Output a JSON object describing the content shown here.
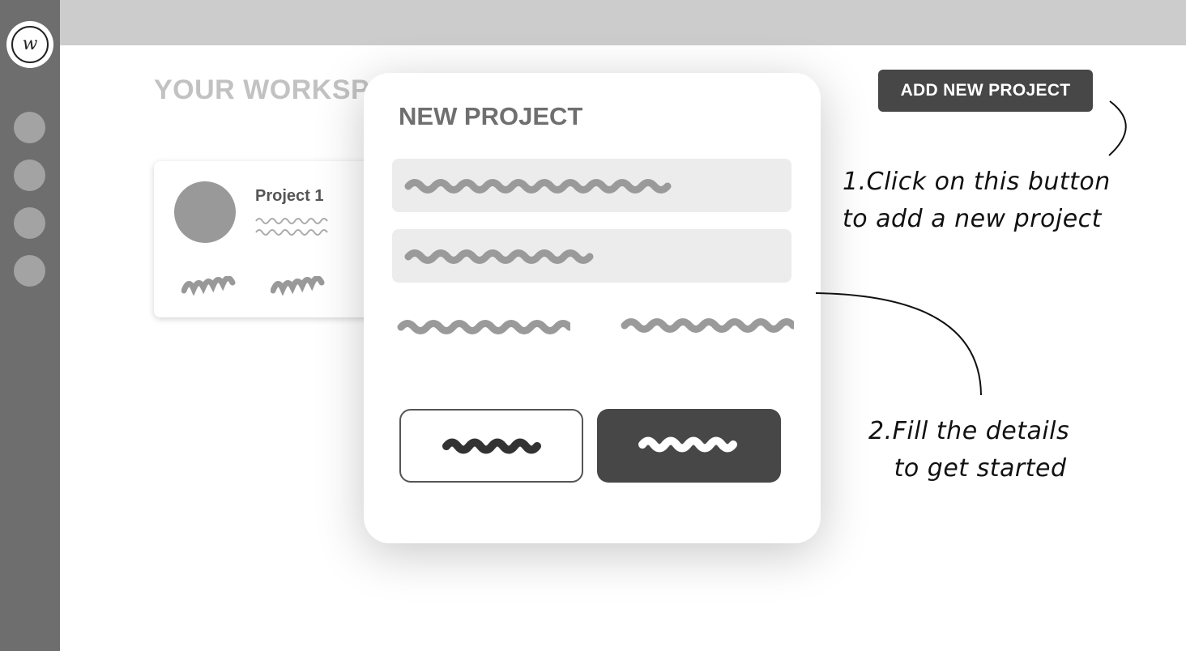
{
  "sidebar": {
    "logo_letter": "w",
    "items": [
      "nav-1",
      "nav-2",
      "nav-3",
      "nav-4"
    ]
  },
  "workspace": {
    "title": "YOUR WORKSPACE",
    "add_button_label": "ADD NEW PROJECT",
    "cards": [
      {
        "title": "Project 1"
      }
    ]
  },
  "modal": {
    "title": "NEW PROJECT"
  },
  "annotations": {
    "step1_line1": "1.Click on this button",
    "step1_line2": "to add a new project",
    "step2_line1": "2.Fill the details",
    "step2_line2": "to get started"
  }
}
